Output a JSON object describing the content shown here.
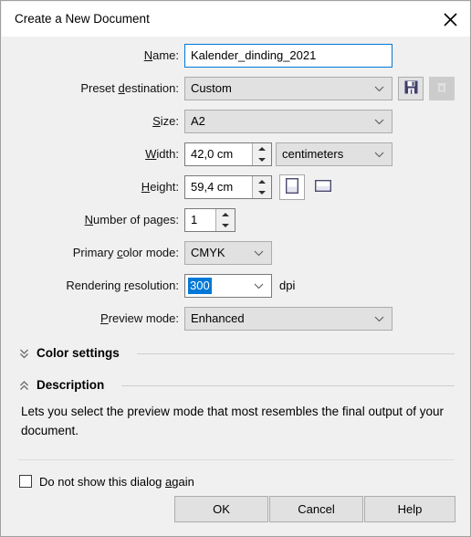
{
  "dialog": {
    "title": "Create a New Document",
    "close_icon": "close-icon"
  },
  "fields": {
    "name": {
      "label_pre": "",
      "label_accel": "N",
      "label_post": "ame:",
      "value": "Kalender_dinding_2021"
    },
    "preset_destination": {
      "label_pre": "Preset ",
      "label_accel": "d",
      "label_post": "estination:",
      "value": "Custom",
      "save_icon": "save-icon",
      "delete_icon": "trash-icon"
    },
    "size": {
      "label_pre": "",
      "label_accel": "S",
      "label_post": "ize:",
      "value": "A2"
    },
    "width": {
      "label_pre": "",
      "label_accel": "W",
      "label_post": "idth:",
      "value": "42,0 cm",
      "unit_value": "centimeters"
    },
    "height": {
      "label_pre": "",
      "label_accel": "H",
      "label_post": "eight:",
      "value": "59,4 cm",
      "portrait_icon": "portrait-page-icon",
      "landscape_icon": "landscape-page-icon"
    },
    "number_of_pages": {
      "label_pre": "",
      "label_accel": "N",
      "label_post": "umber of pages:",
      "value": "1"
    },
    "primary_color_mode": {
      "label_pre": "Primary ",
      "label_accel": "c",
      "label_post": "olor mode:",
      "value": "CMYK"
    },
    "rendering_resolution": {
      "label_pre": "Rendering ",
      "label_accel": "r",
      "label_post": "esolution:",
      "value": "300",
      "unit": "dpi"
    },
    "preview_mode": {
      "label_pre": "",
      "label_accel": "P",
      "label_post": "review mode:",
      "value": "Enhanced"
    }
  },
  "sections": {
    "color_settings": {
      "title": "Color settings",
      "chevron_icon": "chevron-double-down-icon",
      "expanded": false
    },
    "description": {
      "title": "Description",
      "chevron_icon": "chevron-double-up-icon",
      "expanded": true,
      "text": "Lets you select the preview mode that most resembles the final output of your document."
    }
  },
  "footer": {
    "dont_show": {
      "label_pre": "Do not show this dialog ",
      "label_accel": "a",
      "label_post": "gain",
      "checked": false
    },
    "ok_label": "OK",
    "cancel_label": "Cancel",
    "help_label": "Help"
  },
  "colors": {
    "dialog_bg": "#f0f0f0",
    "titlebar_bg": "#ffffff",
    "control_bg": "#e1e1e1",
    "focus_border": "#0078d7",
    "selection_bg": "#0078d7",
    "icon_navy": "#3f3f6b"
  }
}
